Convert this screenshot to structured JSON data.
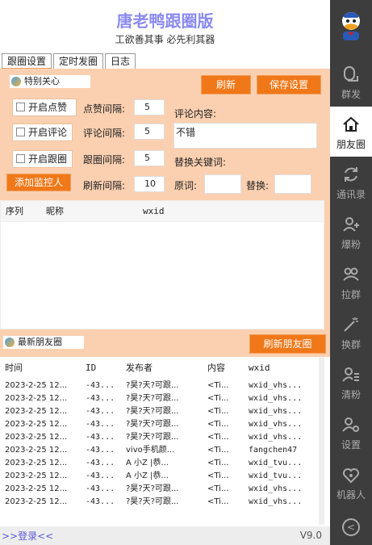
{
  "app": {
    "title": "唐老鸭跟圈版",
    "subtitle": "工欲善其事 必先利其器",
    "version": "V9.0",
    "login": ">>登录<<"
  },
  "tabs": [
    "跟圈设置",
    "定时发圈",
    "日志"
  ],
  "special": {
    "legend": "特别关心",
    "refresh": "刷新",
    "save": "保存设置",
    "enable_like": "开启点赞",
    "enable_comment": "开启评论",
    "enable_follow": "开启跟圈",
    "add_monitor": "添加监控人",
    "like_interval_label": "点赞间隔:",
    "like_interval": "5",
    "comment_interval_label": "评论间隔:",
    "comment_interval": "5",
    "follow_interval_label": "跟圈间隔:",
    "follow_interval": "5",
    "refresh_interval_label": "刷新间隔:",
    "refresh_interval": "10",
    "comment_content_label": "评论内容:",
    "comment_content": "不错",
    "replace_label": "替换关键词:",
    "original_label": "原词:",
    "replace_with_label": "替换:"
  },
  "monitor_list": {
    "columns": [
      "序列",
      "昵称",
      "wxid"
    ]
  },
  "moments": {
    "legend": "最新朋友圈",
    "refresh": "刷新朋友圈",
    "columns": [
      "时间",
      "ID",
      "发布者",
      "内容",
      "wxid"
    ],
    "rows": [
      [
        "2023-2-25 12...",
        "-43...",
        "?昊?天?可跟...",
        "<Ti...",
        "wxid_vhs..."
      ],
      [
        "2023-2-25 12...",
        "-43...",
        "?昊?天?可跟...",
        "<Ti...",
        "wxid_vhs..."
      ],
      [
        "2023-2-25 12...",
        "-43...",
        "?昊?天?可跟...",
        "<Ti...",
        "wxid_vhs..."
      ],
      [
        "2023-2-25 12...",
        "-43...",
        "?昊?天?可跟...",
        "<Ti...",
        "wxid_vhs..."
      ],
      [
        "2023-2-25 12...",
        "-43...",
        "?昊?天?可跟...",
        "<Ti...",
        "wxid_vhs..."
      ],
      [
        "2023-2-25 12...",
        "-43...",
        "vivo手机颜...",
        "<Ti...",
        "fangchen47"
      ],
      [
        "2023-2-25 12...",
        "-43...",
        "A 小Z  |恭...",
        "<Ti...",
        "wxid_tvu..."
      ],
      [
        "2023-2-25 12...",
        "-43...",
        "A 小Z  |恭...",
        "<Ti...",
        "wxid_tvu..."
      ],
      [
        "2023-2-25 12...",
        "-43...",
        "?昊?天?可跟...",
        "<Ti...",
        "wxid_vhs..."
      ],
      [
        "2023-2-25 12...",
        "-43...",
        "?昊?天?可跟...",
        "<Ti...",
        "wxid_vhs..."
      ]
    ]
  },
  "nav": [
    {
      "label": "群发",
      "icon": "mass-send-icon"
    },
    {
      "label": "朋友圈",
      "icon": "home-icon"
    },
    {
      "label": "通讯录",
      "icon": "sync-icon"
    },
    {
      "label": "爆粉",
      "icon": "add-user-icon"
    },
    {
      "label": "拉群",
      "icon": "group-icon"
    },
    {
      "label": "换群",
      "icon": "magic-icon"
    },
    {
      "label": "清粉",
      "icon": "user-list-icon"
    },
    {
      "label": "设置",
      "icon": "user-gear-icon"
    },
    {
      "label": "机器人",
      "icon": "robot-icon"
    }
  ]
}
